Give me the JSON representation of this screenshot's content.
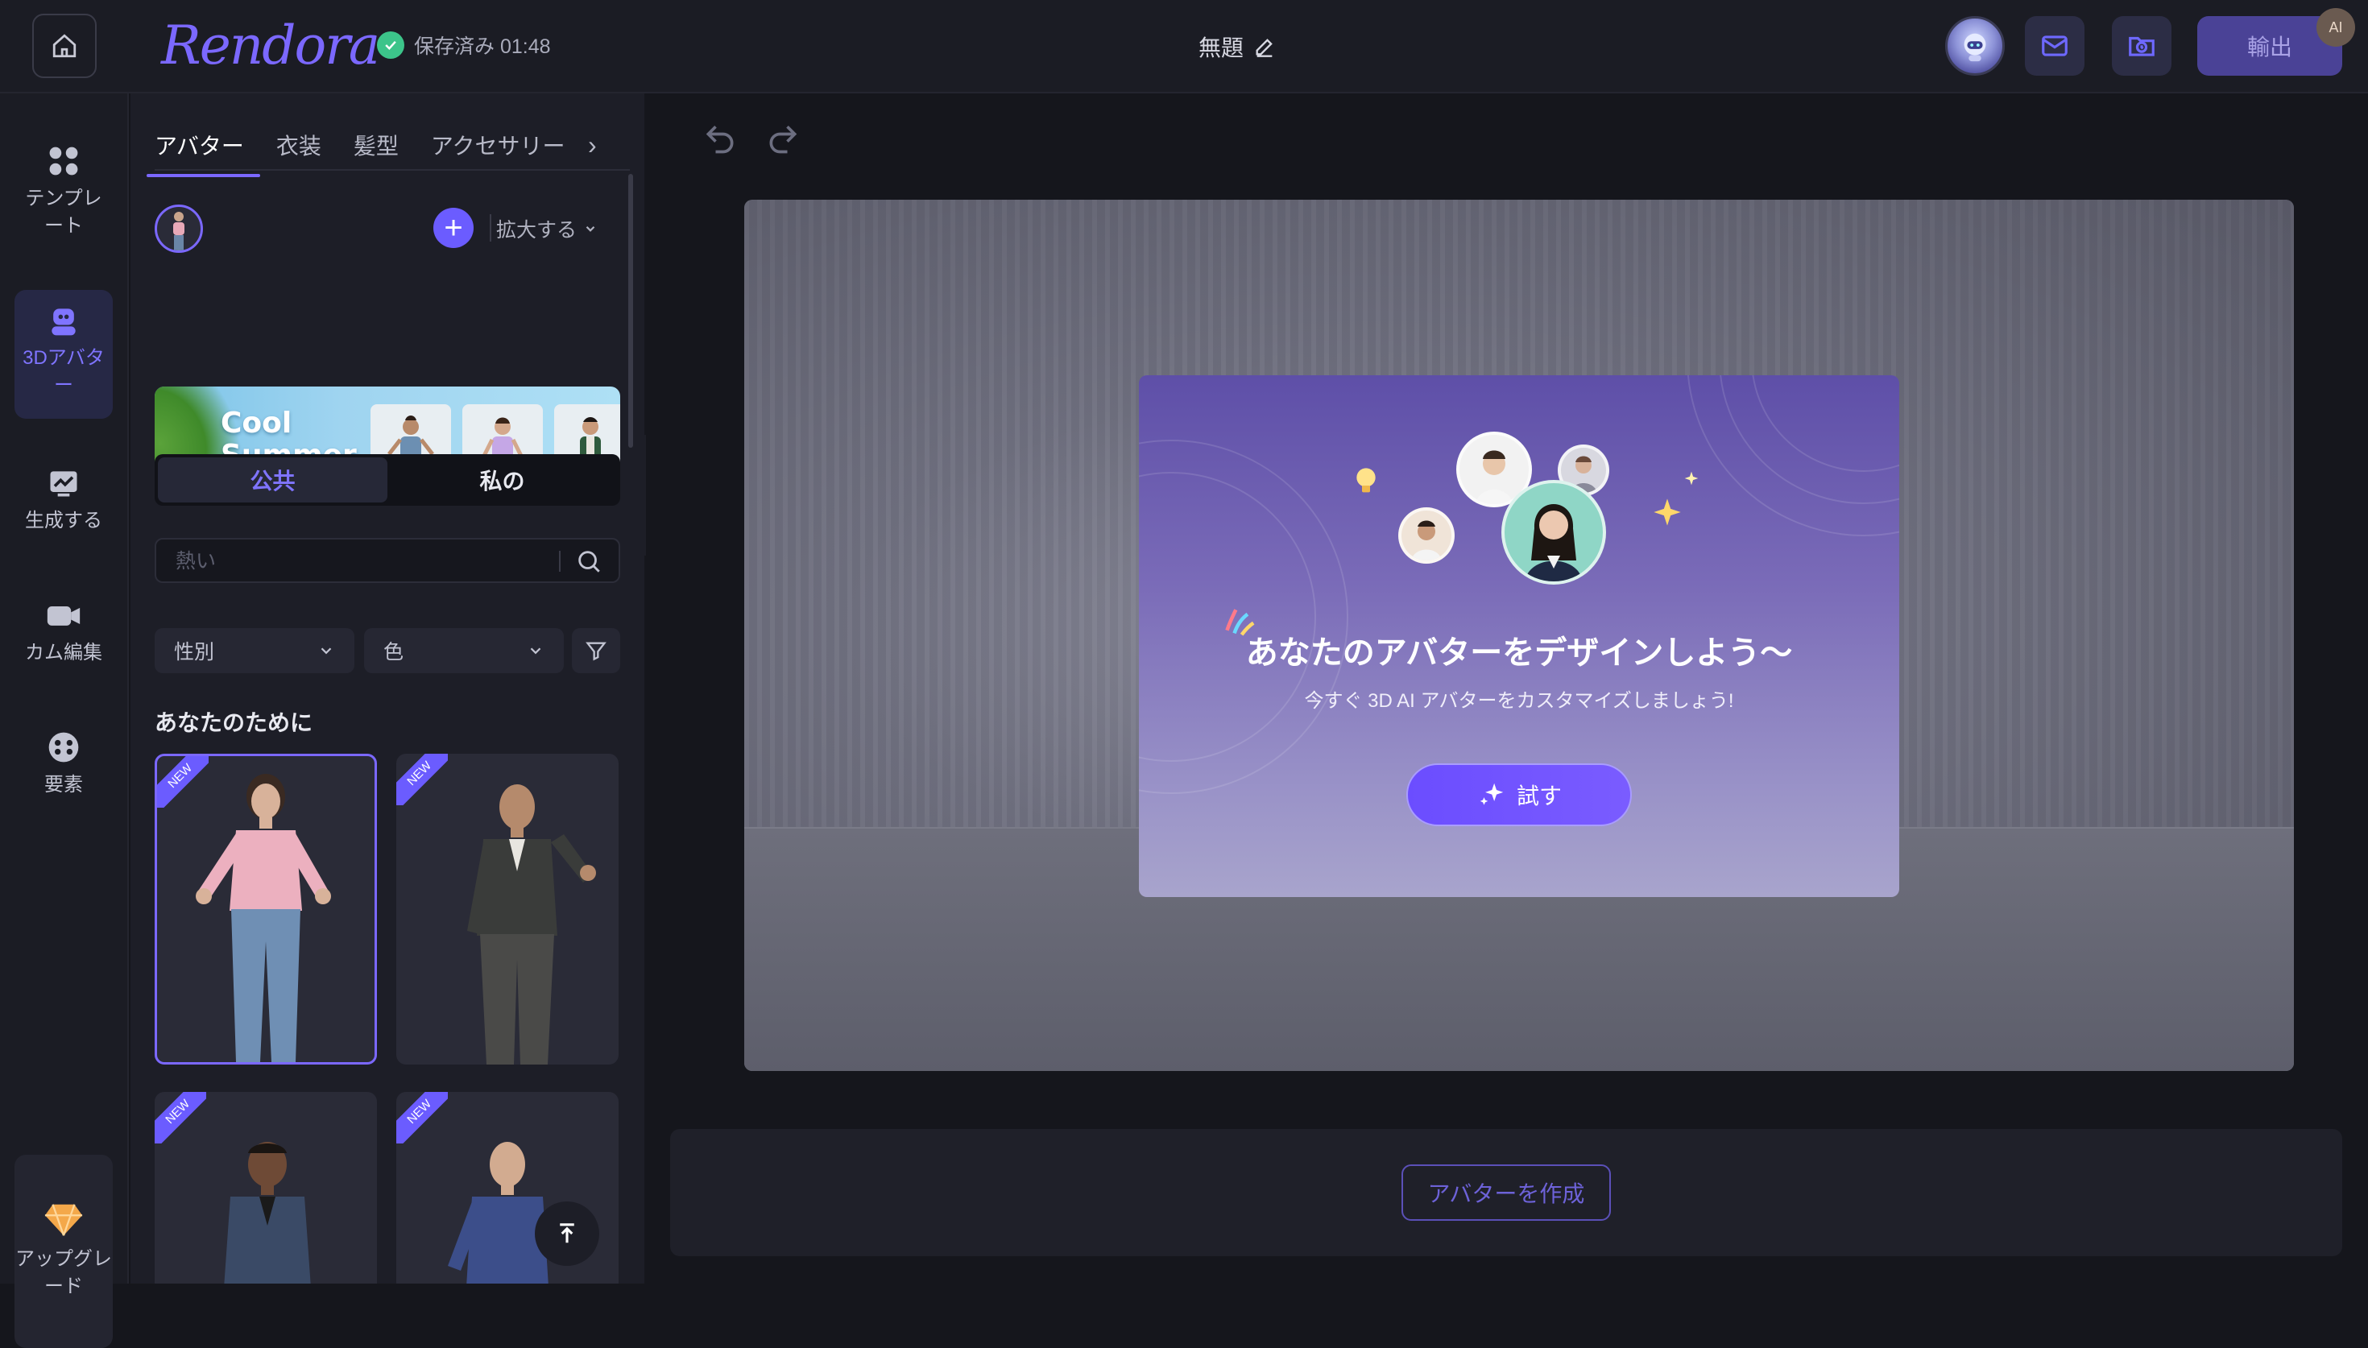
{
  "header": {
    "logo_text": "Rendora",
    "saved_status": "保存済み 01:48",
    "doc_title": "無題",
    "export_label": "輸出",
    "ai_badge": "AI"
  },
  "leftnav": {
    "items": [
      {
        "label": "テンプレート",
        "icon": "grid-icon"
      },
      {
        "label": "3Dアバター",
        "icon": "robot-icon",
        "active": true
      },
      {
        "label": "生成する",
        "icon": "chart-icon"
      },
      {
        "label": "カム編集",
        "icon": "camera-icon"
      },
      {
        "label": "要素",
        "icon": "elements-icon"
      }
    ],
    "upgrade_label": "アップグレード"
  },
  "panel": {
    "tabs": [
      "アバター",
      "衣装",
      "髪型",
      "アクセサリー"
    ],
    "active_tab": "アバター",
    "expand_label": "拡大する",
    "banner": {
      "line1": "Cool",
      "line2": "Summer"
    },
    "segment": {
      "public": "公共",
      "mine": "私の"
    },
    "search_placeholder": "熱い",
    "filters": {
      "gender": "性別",
      "color": "色"
    },
    "section_title": "あなたのために",
    "card_tag": "NEW"
  },
  "canvas": {
    "promo_title": "あなたのアバターをデザインしよう〜",
    "promo_subtitle": "今すぐ 3D AI アバターをカスタマイズしましょう!",
    "try_label": "試す",
    "create_label": "アバターを作成"
  },
  "colors": {
    "accent": "#7b68ff",
    "saved_check": "#3cc48a",
    "export_bg": "#4a4296"
  }
}
